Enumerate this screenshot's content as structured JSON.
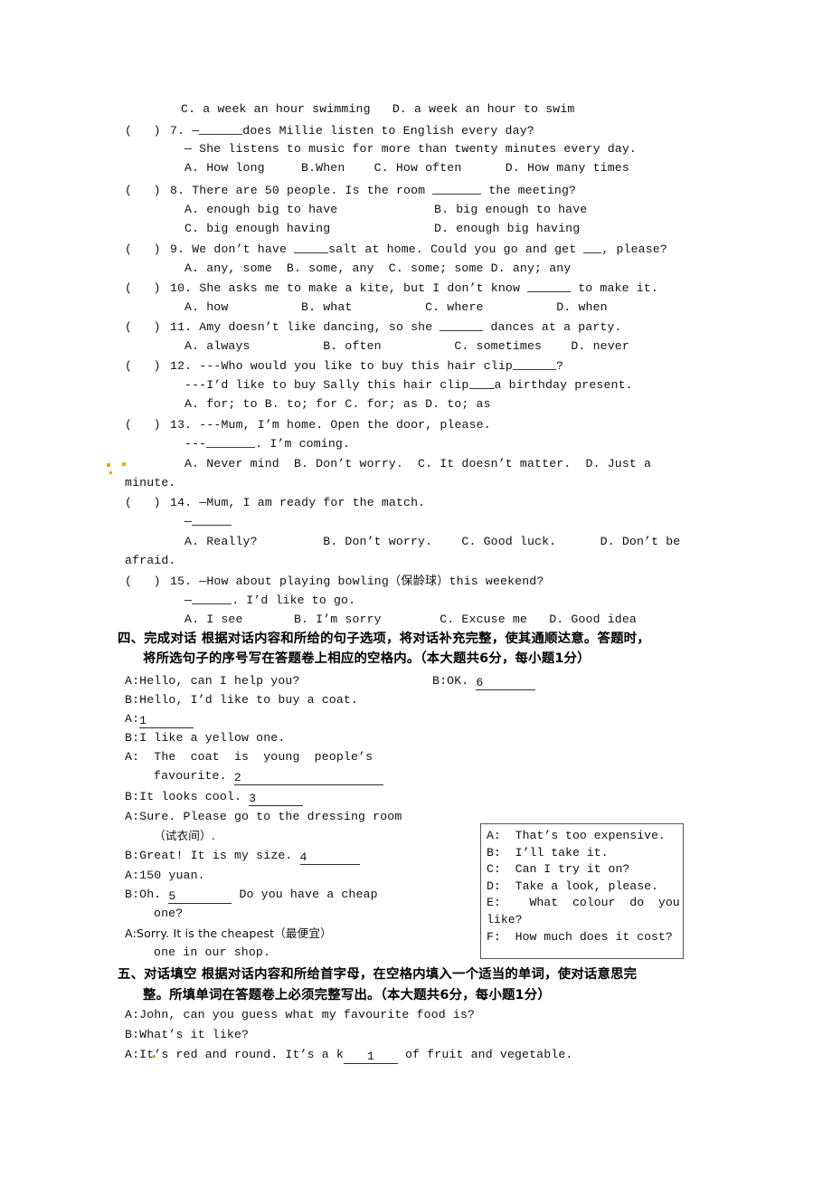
{
  "document": {
    "type": "english-exam-paper",
    "background": "#ffffff",
    "text_color": "#101010"
  },
  "multiple_choice": {
    "q6_tail": "C. a week an hour swimming   D. a week an hour to swim",
    "questions": [
      {
        "marker": "(   ) 7.",
        "number": "7",
        "stem_lines": [
          "7. —",
          "does Millie listen to English every day?",
          "— She listens to music for more than twenty minutes every day."
        ],
        "options_line": "A. How long     B.When    C. How often      D. How many times"
      },
      {
        "marker": "(   ) 8.",
        "number": "8",
        "stem_pre": "8. There are 50 people. Is the room ",
        "stem_post": " the meeting?",
        "options_rows": [
          {
            "left": "A. enough big to have",
            "right": "B. big enough to have"
          },
          {
            "left": "C. big enough having",
            "right": "D. enough big having"
          }
        ]
      },
      {
        "marker": "(   ) 9.",
        "number": "9",
        "stem_a": "9. We don’t have ",
        "stem_b": "salt at home. Could you go and get ",
        "stem_c": ", please?",
        "options_line": "A. any, some  B. some, any  C. some; some D. any; any"
      },
      {
        "marker": "(   ) 10.",
        "number": "10",
        "stem_pre": "10. She asks me to make a kite, but I don’t know ",
        "stem_post": " to make it.",
        "options_line": "A. how          B. what          C. where          D. when"
      },
      {
        "marker": "(   ) 11.",
        "number": "11",
        "stem_pre": "11. Amy doesn’t like dancing, so she ",
        "stem_post": " dances at a party.",
        "options_line": "A. always          B. often          C. sometimes    D. never"
      },
      {
        "marker": "(   ) 12.",
        "number": "12",
        "stem_line1_pre": "12. ---Who would you like to buy this hair clip",
        "stem_line1_post": "?",
        "stem_line2_pre": "---I’d like to buy Sally this hair clip",
        "stem_line2_post": "a birthday present.",
        "options_line": "A. for; to B. to; for C. for; as D. to; as"
      },
      {
        "marker": "(   ) 13.",
        "number": "13",
        "stem_line1": "13. ---Mum, I’m home. Open the door, please.",
        "stem_line2_pre": "---",
        "stem_line2_post": ". I’m coming.",
        "options_line": "A. Never mind  B. Don’t worry.  C. It doesn’t matter.  D. Just a",
        "options_wrap": "minute."
      },
      {
        "marker": "(   ) 14.",
        "number": "14",
        "stem_line1": "14. —Mum, I am ready for the match.",
        "stem_line2": "—",
        "options_line": "A. Really?         B. Don’t worry.    C. Good luck.      D. Don’t be",
        "options_wrap": "afraid."
      },
      {
        "marker": "(   ) 15.",
        "number": "15",
        "stem_line1": "15. —How about playing bowling（保龄球）this weekend?",
        "stem_line2_pre": "—",
        "stem_line2_post": ". I’d like to go.",
        "options_line": "A. I see       B. I’m sorry        C. Excuse me   D. Good idea"
      }
    ]
  },
  "section_four": {
    "heading_line1": "四、完成对话 根据对话内容和所给的句子选项，将对话补充完整，使其通顺达意。答题时，",
    "heading_line2": "将所选句子的序号写在答题卷上相应的空格内。（本大题共6分，每小题1分）",
    "dialogue": [
      {
        "speaker": "A:",
        "text": "Hello, can I help you?"
      },
      {
        "speaker": "B:",
        "text": "Hello, I’d like to buy a coat."
      },
      {
        "speaker": "A:",
        "text": "",
        "blank_number": "1"
      },
      {
        "speaker": "B:",
        "text": "I like a yellow one."
      },
      {
        "speaker": "A:",
        "text": "  The  coat  is  young  people’s"
      },
      {
        "speaker": "",
        "text": "favourite. ",
        "blank_number": "2"
      },
      {
        "speaker": "B:",
        "text": "It looks cool. ",
        "blank_number": "3"
      },
      {
        "speaker": "A:",
        "text": "Sure. Please go to the dressing room"
      },
      {
        "speaker": "",
        "text": "（试衣间）."
      },
      {
        "speaker": "B:",
        "text": "Great! It is my size. ",
        "blank_number": "4"
      },
      {
        "speaker": "A:",
        "text": "150 yuan."
      },
      {
        "speaker": "B:",
        "text": "Oh. ",
        "blank_number": "5",
        "text_after": " Do you have a cheap"
      },
      {
        "speaker": "",
        "text": "one?"
      },
      {
        "speaker": "A:",
        "text": "Sorry. It is the cheapest（最便宜）"
      },
      {
        "speaker": "",
        "text": "one in our shop."
      }
    ],
    "dialogue_right": {
      "speaker": "B:",
      "text": "OK. ",
      "blank_number": "6"
    },
    "options_box": [
      {
        "key": "A:",
        "text": "That’s too expensive."
      },
      {
        "key": "B:",
        "text": "I’ll take it."
      },
      {
        "key": "C:",
        "text": "Can I try it on?"
      },
      {
        "key": "D:",
        "text": "Take a look, please."
      },
      {
        "key": "E:",
        "text": "  What  colour  do  you"
      },
      {
        "key": "",
        "text": "like?"
      },
      {
        "key": "F:",
        "text": "How much does it cost?"
      }
    ]
  },
  "section_five": {
    "heading_line1": "五、对话填空 根据对话内容和所给首字母，在空格内填入一个适当的单词，使对话意思完",
    "heading_line2": "整。所填单词在答题卷上必须完整写出。（本大题共6分，每小题1分）",
    "dialogue": [
      {
        "speaker": "A:",
        "text": "John, can you guess what my favourite food is?"
      },
      {
        "speaker": "B:",
        "text": "What’s it like?"
      },
      {
        "speaker": "A:",
        "pre": "It’s red and round. It’s a k",
        "blank_number": "1",
        "post": " of fruit and vegetable."
      }
    ]
  }
}
